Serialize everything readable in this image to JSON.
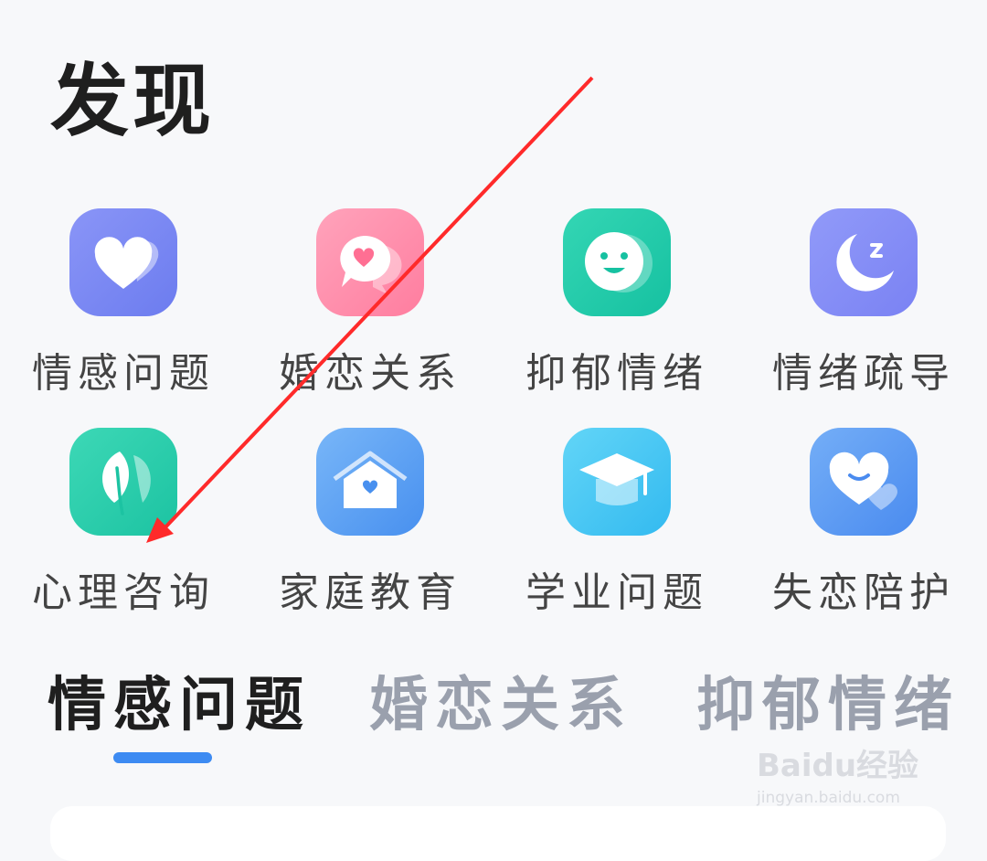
{
  "header": {
    "title": "发现"
  },
  "categories": [
    {
      "label": "情感问题",
      "icon": "heart-icon",
      "color_from": "#7f8cf5",
      "color_to": "#6f7ff0"
    },
    {
      "label": "婚恋关系",
      "icon": "chat-heart-icon",
      "color_from": "#ff9ab3",
      "color_to": "#ff7fa0"
    },
    {
      "label": "抑郁情绪",
      "icon": "smile-face-icon",
      "color_from": "#2fd2b0",
      "color_to": "#18c3a3"
    },
    {
      "label": "情绪疏导",
      "icon": "moon-icon",
      "color_from": "#8c95f8",
      "color_to": "#7b83f4"
    },
    {
      "label": "心理咨询",
      "icon": "leaf-icon",
      "color_from": "#35d3b0",
      "color_to": "#1ec5a3"
    },
    {
      "label": "家庭教育",
      "icon": "house-heart-icon",
      "color_from": "#6fb0f7",
      "color_to": "#4b93f0"
    },
    {
      "label": "学业问题",
      "icon": "graduation-cap-icon",
      "color_from": "#58d0f5",
      "color_to": "#36bdf0"
    },
    {
      "label": "失恋陪护",
      "icon": "heart-smile-icon",
      "color_from": "#6aa6f6",
      "color_to": "#4a8ef0"
    }
  ],
  "tabs": [
    {
      "label": "情感问题",
      "active": true
    },
    {
      "label": "婚恋关系",
      "active": false
    },
    {
      "label": "抑郁情绪",
      "active": false
    }
  ],
  "watermark": {
    "brand": "Baidu经验",
    "sub": "jingyan.baidu.com"
  },
  "annotation": {
    "color": "#ff2a2a"
  },
  "colors": {
    "accent": "#3d8bf2"
  }
}
